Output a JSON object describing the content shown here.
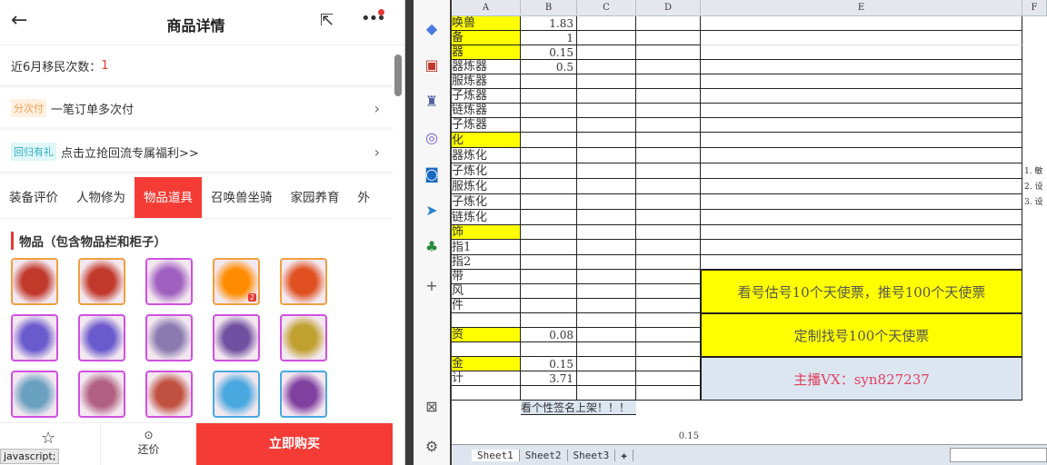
{
  "phone": {
    "title": "商品详情",
    "migration_label": "近6月移民次数：",
    "migration_value": "1",
    "installment_tag": "分次付",
    "installment_text": "一笔订单多次付",
    "return_tag": "回归有礼",
    "return_text": "点击立抢回流专属福利>>",
    "tabs": [
      "装备评价",
      "人物修为",
      "物品道具",
      "召唤兽坐骑",
      "家园养育",
      "外"
    ],
    "active_tab": "物品道具",
    "section_title": "物品（包含物品栏和柜子）",
    "items": [
      {
        "border": "#f0a040",
        "color": "#c0392b"
      },
      {
        "border": "#f0a040",
        "color": "#c0392b",
        "qty": ""
      },
      {
        "border": "#d050e0",
        "color": "#a060c0"
      },
      {
        "border": "#f0a040",
        "color": "#ff8c00",
        "qty": "2"
      },
      {
        "border": "#f0a040",
        "color": "#e05020"
      },
      {
        "border": "#d050e0",
        "color": "#6a5acd"
      },
      {
        "border": "#d050e0",
        "color": "#6a5acd"
      },
      {
        "border": "#d050e0",
        "color": "#8a7ab0"
      },
      {
        "border": "#d050e0",
        "color": "#7050a0"
      },
      {
        "border": "#d050e0",
        "color": "#c0a030"
      },
      {
        "border": "#d050e0",
        "color": "#6aa0c0"
      },
      {
        "border": "#d050e0",
        "color": "#b06080"
      },
      {
        "border": "#d050e0",
        "color": "#c05040"
      },
      {
        "border": "#4aa8e0",
        "color": "#4aa8e0"
      },
      {
        "border": "#4aa8e0",
        "color": "#8040a0"
      }
    ],
    "bottom": {
      "bargain": "还价",
      "buy": "立即购买"
    },
    "status_text": "javascript;"
  },
  "sheet": {
    "columns": [
      "A",
      "B",
      "C",
      "D",
      "E",
      "F"
    ],
    "rows": [
      {
        "a": "唤兽",
        "b": "1.83",
        "y": true
      },
      {
        "a": "备",
        "b": "1",
        "y": true
      },
      {
        "a": "器",
        "b": "0.15",
        "y": true
      },
      {
        "a": "器炼器",
        "b": "0.5"
      },
      {
        "a": "服炼器",
        "b": ""
      },
      {
        "a": "子炼器",
        "b": ""
      },
      {
        "a": "链炼器",
        "b": ""
      },
      {
        "a": "子炼器",
        "b": ""
      },
      {
        "a": "化",
        "b": "",
        "y": true
      },
      {
        "a": "器炼化",
        "b": ""
      },
      {
        "a": "子炼化",
        "b": ""
      },
      {
        "a": "服炼化",
        "b": ""
      },
      {
        "a": "子炼化",
        "b": ""
      },
      {
        "a": "链炼化",
        "b": ""
      },
      {
        "a": "饰",
        "b": "",
        "y": true
      },
      {
        "a": "指1",
        "b": ""
      },
      {
        "a": "指2",
        "b": ""
      },
      {
        "a": "带",
        "b": ""
      },
      {
        "a": "风",
        "b": ""
      },
      {
        "a": "件",
        "b": ""
      },
      {
        "a": "",
        "b": ""
      },
      {
        "a": "资",
        "b": "0.08",
        "y": true
      },
      {
        "a": "",
        "b": ""
      },
      {
        "a": "金",
        "b": "0.15",
        "y": true
      },
      {
        "a": "计",
        "b": "3.71"
      },
      {
        "a": "",
        "b": ""
      }
    ],
    "signature_row": "看个性签名上架！！！",
    "stray_value": "0.15",
    "f_notes": [
      "1. 敏",
      "2. 设",
      "3. 设"
    ],
    "merged": [
      "看号估号10个天使票，推号100个天使票",
      "定制找号100个天使票",
      "主播VX：syn827237"
    ],
    "sheet_tabs": [
      "Sheet1",
      "Sheet2",
      "Sheet3"
    ]
  }
}
